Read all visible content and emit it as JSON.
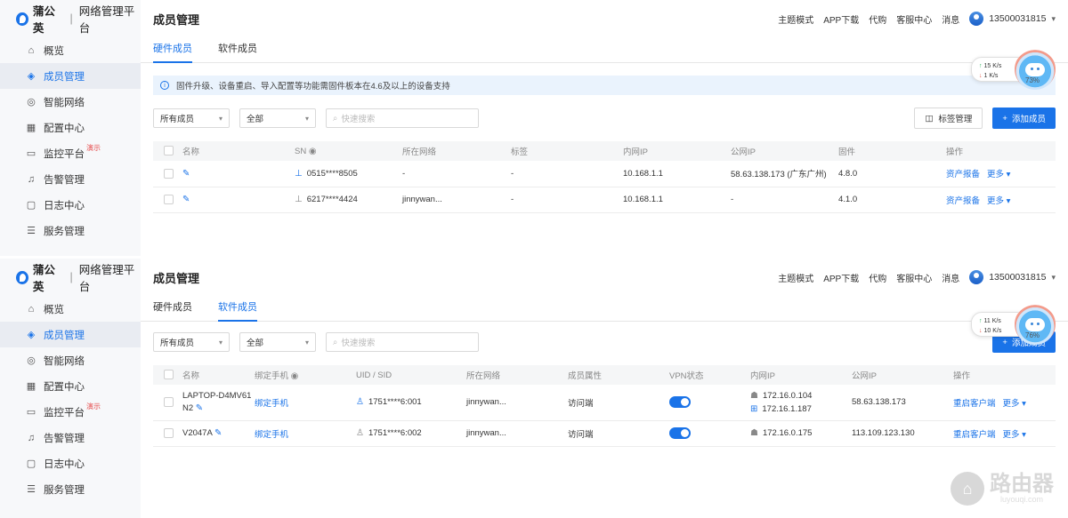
{
  "brand": {
    "name": "蒲公英",
    "product": "网络管理平台"
  },
  "nav": {
    "items": [
      {
        "label": "概览",
        "icon": "home-icon"
      },
      {
        "label": "成员管理",
        "icon": "layers-icon"
      },
      {
        "label": "智能网络",
        "icon": "network-icon"
      },
      {
        "label": "配置中心",
        "icon": "grid-icon"
      },
      {
        "label": "监控平台",
        "icon": "monitor-icon",
        "badge": "演示"
      },
      {
        "label": "告警管理",
        "icon": "bell-icon"
      },
      {
        "label": "日志中心",
        "icon": "log-icon"
      },
      {
        "label": "服务管理",
        "icon": "service-icon"
      }
    ]
  },
  "header": {
    "title": "成员管理",
    "links": [
      "主题模式",
      "APP下载",
      "代购",
      "客服中心",
      "消息"
    ],
    "user": "13500031815"
  },
  "tabs": [
    "硬件成员",
    "软件成员"
  ],
  "notice": "固件升级、设备重启、导入配置等功能需固件板本在4.6及以上的设备支持",
  "filters": {
    "member_select": "所有成员",
    "status_select": "全部",
    "search_placeholder": "快速搜索"
  },
  "buttons": {
    "tag_manage": "标签管理",
    "add_member": "添加成员"
  },
  "hardware": {
    "columns": [
      "名称",
      "SN",
      "所在网络",
      "标签",
      "内网IP",
      "公网IP",
      "固件",
      "操作"
    ],
    "rows": [
      {
        "sn": "0515****8505",
        "network": "-",
        "tag": "-",
        "lan_ip": "10.168.1.1",
        "wan_ip": "58.63.138.173 (广东广州)",
        "firmware": "4.8.0",
        "action": "资产报备",
        "more": "更多"
      },
      {
        "sn": "6217****4424",
        "network": "jinnywan...",
        "tag": "-",
        "lan_ip": "10.168.1.1",
        "wan_ip": "-",
        "firmware": "4.1.0",
        "action": "资产报备",
        "more": "更多"
      }
    ]
  },
  "software": {
    "columns": [
      "名称",
      "绑定手机",
      "UID / SID",
      "所在网络",
      "成员属性",
      "VPN状态",
      "内网IP",
      "公网IP",
      "操作"
    ],
    "rows": [
      {
        "name": "LAPTOP-D4MV61N2",
        "phone": "绑定手机",
        "uid": "1751****6:001",
        "network": "jinnywan...",
        "attr": "访问端",
        "lan_ip_1": "172.16.0.104",
        "lan_ip_2": "172.16.1.187",
        "wan_ip": "58.63.138.173",
        "action": "重启客户端",
        "more": "更多"
      },
      {
        "name": "V2047A",
        "phone": "绑定手机",
        "uid": "1751****6:002",
        "network": "jinnywan...",
        "attr": "访问端",
        "lan_ip_1": "172.16.0.175",
        "wan_ip": "113.109.123.130",
        "action": "重启客户端",
        "more": "更多"
      }
    ]
  },
  "speed_top": {
    "up": "15",
    "down": "1",
    "unit": "K/s",
    "pct": "73",
    "pct_unit": "%"
  },
  "speed_bottom": {
    "up": "11",
    "down": "10",
    "unit": "K/s",
    "pct": "76",
    "pct_unit": "%"
  },
  "watermark": {
    "text": "路由器",
    "url": "luyouqi.com"
  },
  "colors": {
    "accent": "#1a73e8",
    "sidebar_bg": "#f7f8fa"
  }
}
